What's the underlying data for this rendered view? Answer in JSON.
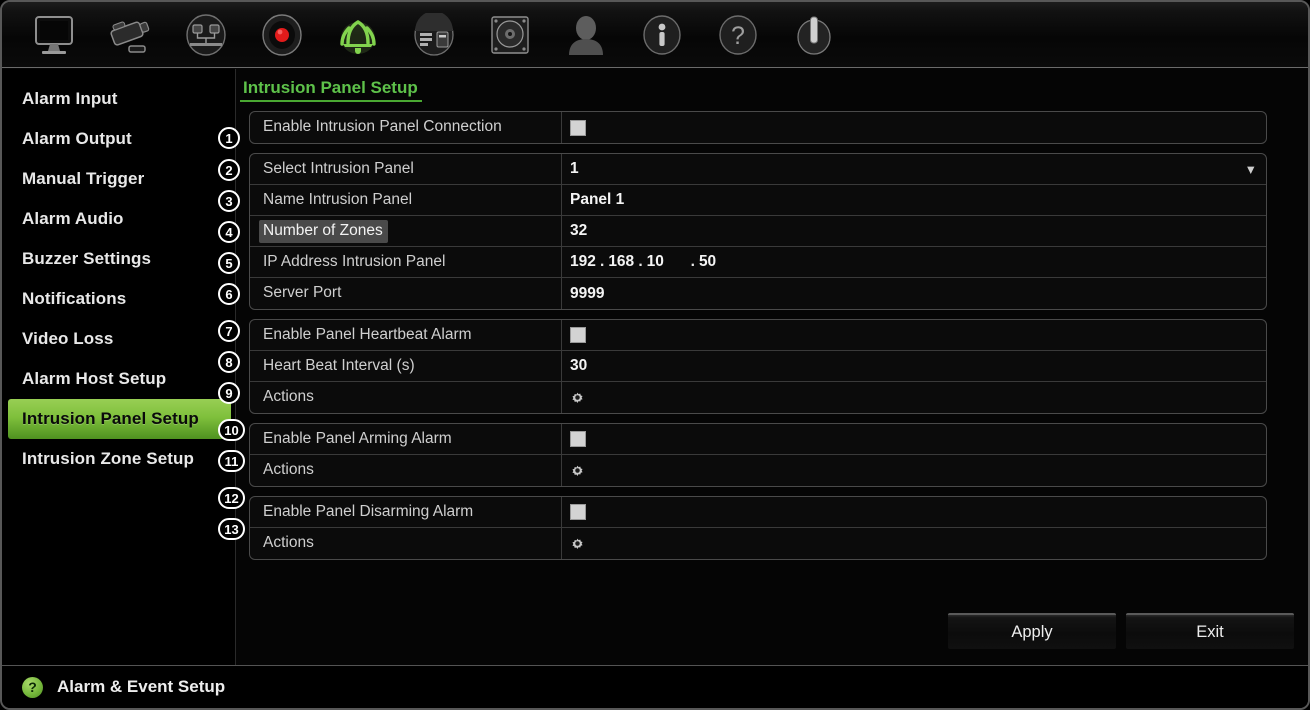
{
  "toolbar": {
    "icons": [
      {
        "name": "monitor-display-icon",
        "label": "Display"
      },
      {
        "name": "camera-icon",
        "label": "Camera"
      },
      {
        "name": "network-icon",
        "label": "Network"
      },
      {
        "name": "record-icon",
        "label": "Record"
      },
      {
        "name": "alarm-bell-icon",
        "label": "Alarm",
        "active": true
      },
      {
        "name": "device-settings-icon",
        "label": "Device Management"
      },
      {
        "name": "hard-drive-icon",
        "label": "Storage"
      },
      {
        "name": "user-icon",
        "label": "User Management"
      },
      {
        "name": "info-icon",
        "label": "System Info"
      },
      {
        "name": "help-icon",
        "label": "Help"
      },
      {
        "name": "power-icon",
        "label": "Shutdown"
      }
    ]
  },
  "sidebar": {
    "items": [
      {
        "label": "Alarm Input",
        "active": false
      },
      {
        "label": "Alarm Output",
        "active": false
      },
      {
        "label": "Manual Trigger",
        "active": false
      },
      {
        "label": "Alarm Audio",
        "active": false
      },
      {
        "label": "Buzzer Settings",
        "active": false
      },
      {
        "label": "Notifications",
        "active": false
      },
      {
        "label": "Video Loss",
        "active": false
      },
      {
        "label": "Alarm Host Setup",
        "active": false
      },
      {
        "label": "Intrusion Panel Setup",
        "active": true
      },
      {
        "label": "Intrusion Zone Setup",
        "active": false
      }
    ]
  },
  "main": {
    "title": "Intrusion Panel Setup",
    "groups": [
      {
        "rows": [
          {
            "num": "1",
            "label": "Enable Intrusion Panel Connection",
            "type": "checkbox",
            "value": "",
            "checked": false,
            "focused": false
          }
        ]
      },
      {
        "rows": [
          {
            "num": "2",
            "label": "Select Intrusion Panel",
            "type": "dropdown",
            "value": "1",
            "focused": false
          },
          {
            "num": "3",
            "label": "Name Intrusion Panel",
            "type": "text",
            "value": "Panel 1",
            "focused": false
          },
          {
            "num": "4",
            "label": "Number of Zones",
            "type": "text",
            "value": "32",
            "focused": true
          },
          {
            "num": "5",
            "label": "IP Address Intrusion Panel",
            "type": "ip",
            "value": "192 . 168 . 10 . 50",
            "octets": [
              "192",
              "168",
              "10",
              "50"
            ],
            "focused": false
          },
          {
            "num": "6",
            "label": "Server Port",
            "type": "text",
            "value": "9999",
            "focused": false
          }
        ]
      },
      {
        "rows": [
          {
            "num": "7",
            "label": "Enable Panel Heartbeat Alarm",
            "type": "checkbox",
            "value": "",
            "checked": false,
            "focused": false
          },
          {
            "num": "8",
            "label": "Heart Beat Interval (s)",
            "type": "text",
            "value": "30",
            "focused": false
          },
          {
            "num": "9",
            "label": "Actions",
            "type": "gear",
            "value": "",
            "focused": false
          }
        ]
      },
      {
        "rows": [
          {
            "num": "10",
            "label": "Enable Panel Arming Alarm",
            "type": "checkbox",
            "value": "",
            "checked": false,
            "focused": false
          },
          {
            "num": "11",
            "label": "Actions",
            "type": "gear",
            "value": "",
            "focused": false
          }
        ]
      },
      {
        "rows": [
          {
            "num": "12",
            "label": "Enable Panel Disarming Alarm",
            "type": "checkbox",
            "value": "",
            "checked": false,
            "focused": false
          },
          {
            "num": "13",
            "label": "Actions",
            "type": "gear",
            "value": "",
            "focused": false
          }
        ]
      }
    ]
  },
  "footer": {
    "apply_label": "Apply",
    "exit_label": "Exit"
  },
  "statusbar": {
    "help_glyph": "?",
    "text": "Alarm & Event Setup"
  },
  "colors": {
    "accent_green": "#5ec24a",
    "selection_green": "#7fc03c",
    "panel_bg": "#050505",
    "row_border": "#3a3a3a"
  }
}
